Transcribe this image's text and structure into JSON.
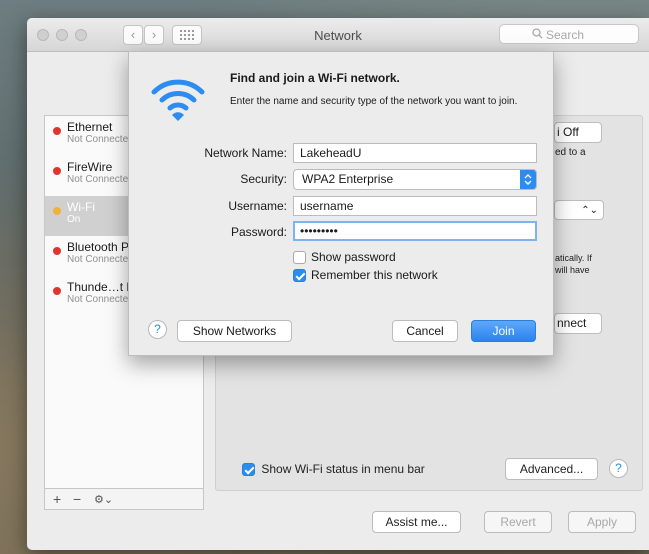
{
  "window": {
    "title": "Network"
  },
  "search": {
    "placeholder": "Search"
  },
  "services": [
    {
      "name": "Ethernet",
      "status": "Not Connected",
      "color": "#e0342e"
    },
    {
      "name": "FireWire",
      "status": "Not Connected",
      "color": "#e0342e"
    },
    {
      "name": "Wi-Fi",
      "status": "On",
      "color": "#f1b13b"
    },
    {
      "name": "Bluetooth PAN",
      "status": "Not Connected",
      "color": "#e0342e"
    },
    {
      "name": "Thunde…t Bridge",
      "status": "Not Connected",
      "color": "#e0342e"
    }
  ],
  "service_bar": {
    "add": "+",
    "remove": "−",
    "action": "⚙⌄"
  },
  "pane": {
    "turn_off_label": "i Off",
    "text_connected": "ed to a",
    "text_auto_1": "atically. If",
    "text_auto_2": "will have",
    "connect_label": "nnect",
    "show_status_label": "Show Wi-Fi status in menu bar",
    "show_status_checked": true,
    "advanced_label": "Advanced...",
    "help": "?"
  },
  "footer": {
    "assist_label": "Assist me...",
    "revert_label": "Revert",
    "apply_label": "Apply"
  },
  "dialog": {
    "title": "Find and join a Wi-Fi network.",
    "description": "Enter the name and security type of the network you want to join.",
    "network_name_label": "Network Name:",
    "network_name_value": "LakeheadU",
    "security_label": "Security:",
    "security_value": "WPA2 Enterprise",
    "username_label": "Username:",
    "username_value": "username",
    "password_label": "Password:",
    "password_value": "•••••••••",
    "show_password_label": "Show password",
    "show_password_checked": false,
    "remember_label": "Remember this network",
    "remember_checked": true,
    "help": "?",
    "show_networks_label": "Show Networks",
    "cancel_label": "Cancel",
    "join_label": "Join"
  },
  "colors": {
    "accent": "#2d8cf0",
    "wifi_icon": "#2d8cf0"
  }
}
